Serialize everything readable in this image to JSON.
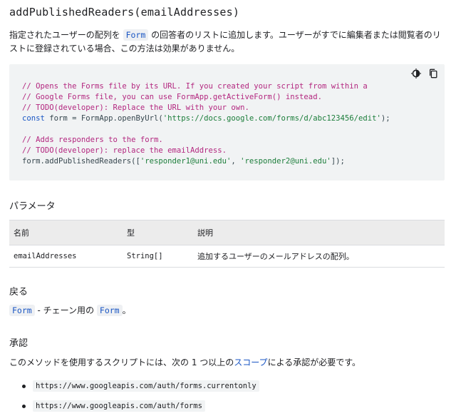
{
  "title": "addPublishedReaders(emailAddresses)",
  "description": {
    "part1": "指定されたユーザーの配列を ",
    "chip": "Form",
    "part2": " の回答者のリストに追加します。ユーザーがすでに編集者または閲覧者のリストに登録されている場合、この方法は効果がありません。"
  },
  "code": {
    "icons": [
      "theme-toggle-icon",
      "copy-icon"
    ],
    "lines": {
      "l1": "// Opens the Forms file by its URL. If you created your script from within a",
      "l2": "// Google Forms file, you can use FormApp.getActiveForm() instead.",
      "l3": "// TODO(developer): Replace the URL with your own.",
      "l4_kw": "const",
      "l4_mid": " form = FormApp.openByUrl(",
      "l4_str": "'https://docs.google.com/forms/d/abc123456/edit'",
      "l4_end": ");",
      "l6": "// Adds responders to the form.",
      "l7": "// TODO(developer): replace the emailAddress.",
      "l8_a": "form.addPublishedReaders([",
      "l8_s1": "'responder1@uni.edu'",
      "l8_b": ", ",
      "l8_s2": "'responder2@uni.edu'",
      "l8_c": "]);"
    }
  },
  "params": {
    "heading": "パラメータ",
    "headers": {
      "name": "名前",
      "type": "型",
      "desc": "説明"
    },
    "rows": [
      {
        "name": "emailAddresses",
        "type": "String[]",
        "desc": "追加するユーザーのメールアドレスの配列。"
      }
    ]
  },
  "returns": {
    "heading": "戻る",
    "chip1": "Form",
    "mid": " - チェーン用の ",
    "chip2": "Form",
    "end": "。"
  },
  "auth": {
    "heading": "承認",
    "desc_part1": "このメソッドを使用するスクリプトには、次の 1 つ以上の",
    "link": "スコープ",
    "desc_part2": "による承認が必要です。",
    "scopes": [
      "https://www.googleapis.com/auth/forms.currentonly",
      "https://www.googleapis.com/auth/forms"
    ]
  }
}
